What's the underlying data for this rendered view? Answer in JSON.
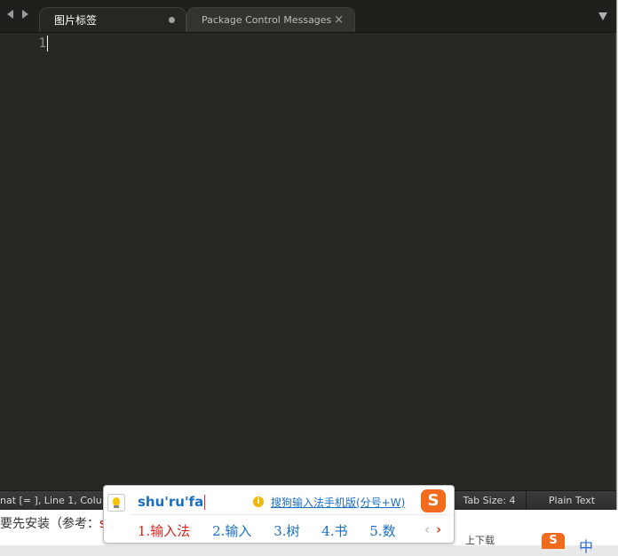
{
  "tabs": [
    {
      "label": "图片标签",
      "dirty": true
    },
    {
      "label": "Package Control Messages",
      "close": "×"
    }
  ],
  "editor": {
    "line_number": "1"
  },
  "statusbar": {
    "left": "nat [=     ], Line 1, Colu",
    "tab_size": "Tab Size: 4",
    "syntax": "Plain Text"
  },
  "page_below": {
    "text_prefix": "要先安装（参考：",
    "text_red": "su",
    "right_text": "上下载",
    "zh": "中"
  },
  "ime": {
    "composition": "shu'ru'fa",
    "hint": "搜狗输入法手机版(分号+W)",
    "hint_icon": "i",
    "logo": "S",
    "candidates": [
      "1.输入法",
      "2.输入",
      "3.树",
      "4.书",
      "5.数"
    ],
    "prev": "‹",
    "next": "›"
  },
  "colors": {
    "editor_bg": "#272822",
    "accent_blue": "#1b6fc2",
    "candidate_red": "#d7261e",
    "sogou_orange": "#f26a1b"
  }
}
